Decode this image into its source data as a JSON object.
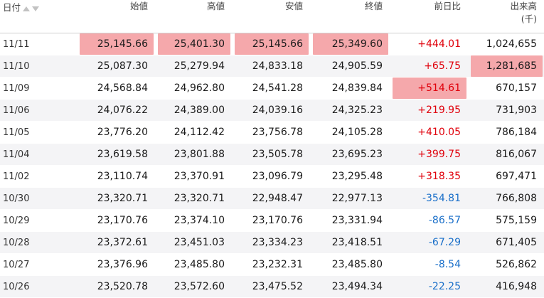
{
  "headers": {
    "date": "日付",
    "open": "始値",
    "high": "高値",
    "low": "安値",
    "close": "終値",
    "change": "前日比",
    "volume_line1": "出来高",
    "volume_line2": "(千)"
  },
  "rows": [
    {
      "date": "11/11",
      "open": "25,145.66",
      "high": "25,401.30",
      "low": "25,145.66",
      "close": "25,349.60",
      "change": "+444.01",
      "change_dir": "up",
      "volume": "1,024,655",
      "highlight": [
        "open",
        "high",
        "low",
        "close"
      ]
    },
    {
      "date": "11/10",
      "open": "25,087.30",
      "high": "25,279.94",
      "low": "24,833.18",
      "close": "24,905.59",
      "change": "+65.75",
      "change_dir": "up",
      "volume": "1,281,685",
      "highlight": [
        "volume"
      ]
    },
    {
      "date": "11/09",
      "open": "24,568.84",
      "high": "24,962.80",
      "low": "24,541.28",
      "close": "24,839.84",
      "change": "+514.61",
      "change_dir": "up",
      "volume": "670,157",
      "highlight": [
        "change"
      ]
    },
    {
      "date": "11/06",
      "open": "24,076.22",
      "high": "24,389.00",
      "low": "24,039.16",
      "close": "24,325.23",
      "change": "+219.95",
      "change_dir": "up",
      "volume": "731,903",
      "highlight": []
    },
    {
      "date": "11/05",
      "open": "23,776.20",
      "high": "24,112.42",
      "low": "23,756.78",
      "close": "24,105.28",
      "change": "+410.05",
      "change_dir": "up",
      "volume": "786,184",
      "highlight": []
    },
    {
      "date": "11/04",
      "open": "23,619.58",
      "high": "23,801.88",
      "low": "23,505.78",
      "close": "23,695.23",
      "change": "+399.75",
      "change_dir": "up",
      "volume": "816,067",
      "highlight": []
    },
    {
      "date": "11/02",
      "open": "23,110.74",
      "high": "23,370.91",
      "low": "23,096.79",
      "close": "23,295.48",
      "change": "+318.35",
      "change_dir": "up",
      "volume": "697,471",
      "highlight": []
    },
    {
      "date": "10/30",
      "open": "23,320.71",
      "high": "23,320.71",
      "low": "22,948.47",
      "close": "22,977.13",
      "change": "-354.81",
      "change_dir": "down",
      "volume": "766,808",
      "highlight": []
    },
    {
      "date": "10/29",
      "open": "23,170.76",
      "high": "23,374.10",
      "low": "23,170.76",
      "close": "23,331.94",
      "change": "-86.57",
      "change_dir": "down",
      "volume": "575,159",
      "highlight": []
    },
    {
      "date": "10/28",
      "open": "23,372.61",
      "high": "23,451.03",
      "low": "23,334.23",
      "close": "23,418.51",
      "change": "-67.29",
      "change_dir": "down",
      "volume": "671,405",
      "highlight": []
    },
    {
      "date": "10/27",
      "open": "23,376.96",
      "high": "23,485.80",
      "low": "23,232.31",
      "close": "23,485.80",
      "change": "-8.54",
      "change_dir": "down",
      "volume": "526,862",
      "highlight": []
    },
    {
      "date": "10/26",
      "open": "23,520.78",
      "high": "23,572.60",
      "low": "23,475.52",
      "close": "23,494.34",
      "change": "-22.25",
      "change_dir": "down",
      "volume": "416,948",
      "highlight": []
    }
  ],
  "colors": {
    "highlight_bg": "#f5a8ab",
    "positive": "#e0000b",
    "negative": "#1a6fc9",
    "row_alt": "#f4f4f6"
  },
  "icons": {
    "sort_asc": "sort-ascending-icon",
    "sort_desc": "sort-descending-icon"
  }
}
